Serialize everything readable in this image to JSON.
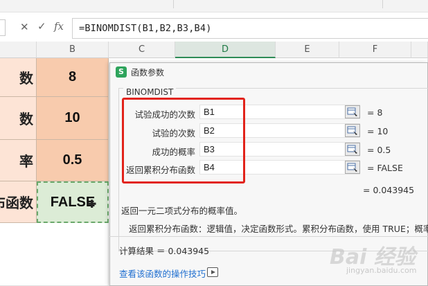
{
  "formula_bar": {
    "cancel_icon": "close-icon",
    "confirm_icon": "check-icon",
    "fx_label": "fx",
    "formula": "=BINOMDIST(B1,B2,B3,B4)"
  },
  "columns": [
    "B",
    "C",
    "D",
    "E",
    "F"
  ],
  "active_column": "D",
  "sheet": {
    "rows": [
      {
        "a_label": "数",
        "b_value": "8"
      },
      {
        "a_label": "数",
        "b_value": "10"
      },
      {
        "a_label": "率",
        "b_value": "0.5"
      },
      {
        "a_label": "布函数",
        "b_value": "FALSE"
      }
    ]
  },
  "dialog": {
    "title": "函数参数",
    "logo_letter": "S",
    "function_name": "BINOMDIST",
    "args": [
      {
        "label": "试验成功的次数",
        "value": "B1",
        "result": "= 8"
      },
      {
        "label": "试验的次数",
        "value": "B2",
        "result": "= 10"
      },
      {
        "label": "成功的概率",
        "value": "B3",
        "result": "= 0.5"
      },
      {
        "label": "返回累积分布函数",
        "value": "B4",
        "result": "= FALSE"
      }
    ],
    "total": "= 0.043945",
    "description": "返回一元二项式分布的概率值。",
    "arg_description": "返回累积分布函数：逻辑值，决定函数形式。累积分布函数，使用 TRUE；概率密",
    "calc_result": "计算结果 ＝ 0.043945",
    "tips_link": "查看该函数的操作技巧"
  },
  "watermark": {
    "text": "Bai 经验",
    "sub": "jingyan.baidu.com"
  },
  "colors": {
    "label_cell": "#fde4d6",
    "value_cell": "#f8cbad",
    "highlight_box": "#e2231a",
    "wps_green": "#2ea45c",
    "link": "#1f6fd0"
  }
}
